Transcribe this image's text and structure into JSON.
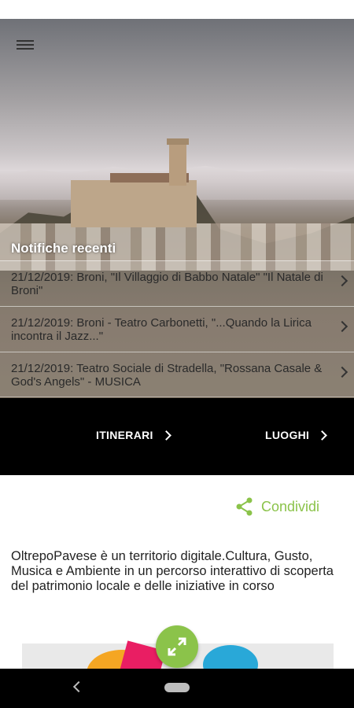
{
  "header": {
    "menu_icon": "hamburger-menu-icon"
  },
  "notifications": {
    "title": "Notifiche recenti",
    "items": [
      {
        "text": "21/12/2019: Broni, \"Il Villaggio di Babbo Natale\" \"Il Natale di Broni\""
      },
      {
        "text": "21/12/2019: Broni - Teatro Carbonetti, \"...Quando la Lirica incontra il Jazz...\""
      },
      {
        "text": "21/12/2019: Teatro Sociale di Stradella, \"Rossana Casale & God's Angels\" - MUSICA"
      }
    ]
  },
  "nav": {
    "itinerari_label": "ITINERARI",
    "luoghi_label": "LUOGHI"
  },
  "share": {
    "label": "Condividi",
    "icon": "share-icon",
    "color": "#8bc34a"
  },
  "description": "OltrepoPavese è un territorio digitale.Cultura, Gusto, Musica e Ambiente in un percorso interattivo di scoperta del patrimonio locale e delle iniziative in corso",
  "fab": {
    "icon": "expand-icon",
    "color": "#8bc34a"
  },
  "system_nav": {
    "back_icon": "back-icon",
    "home_icon": "home-pill-icon"
  }
}
